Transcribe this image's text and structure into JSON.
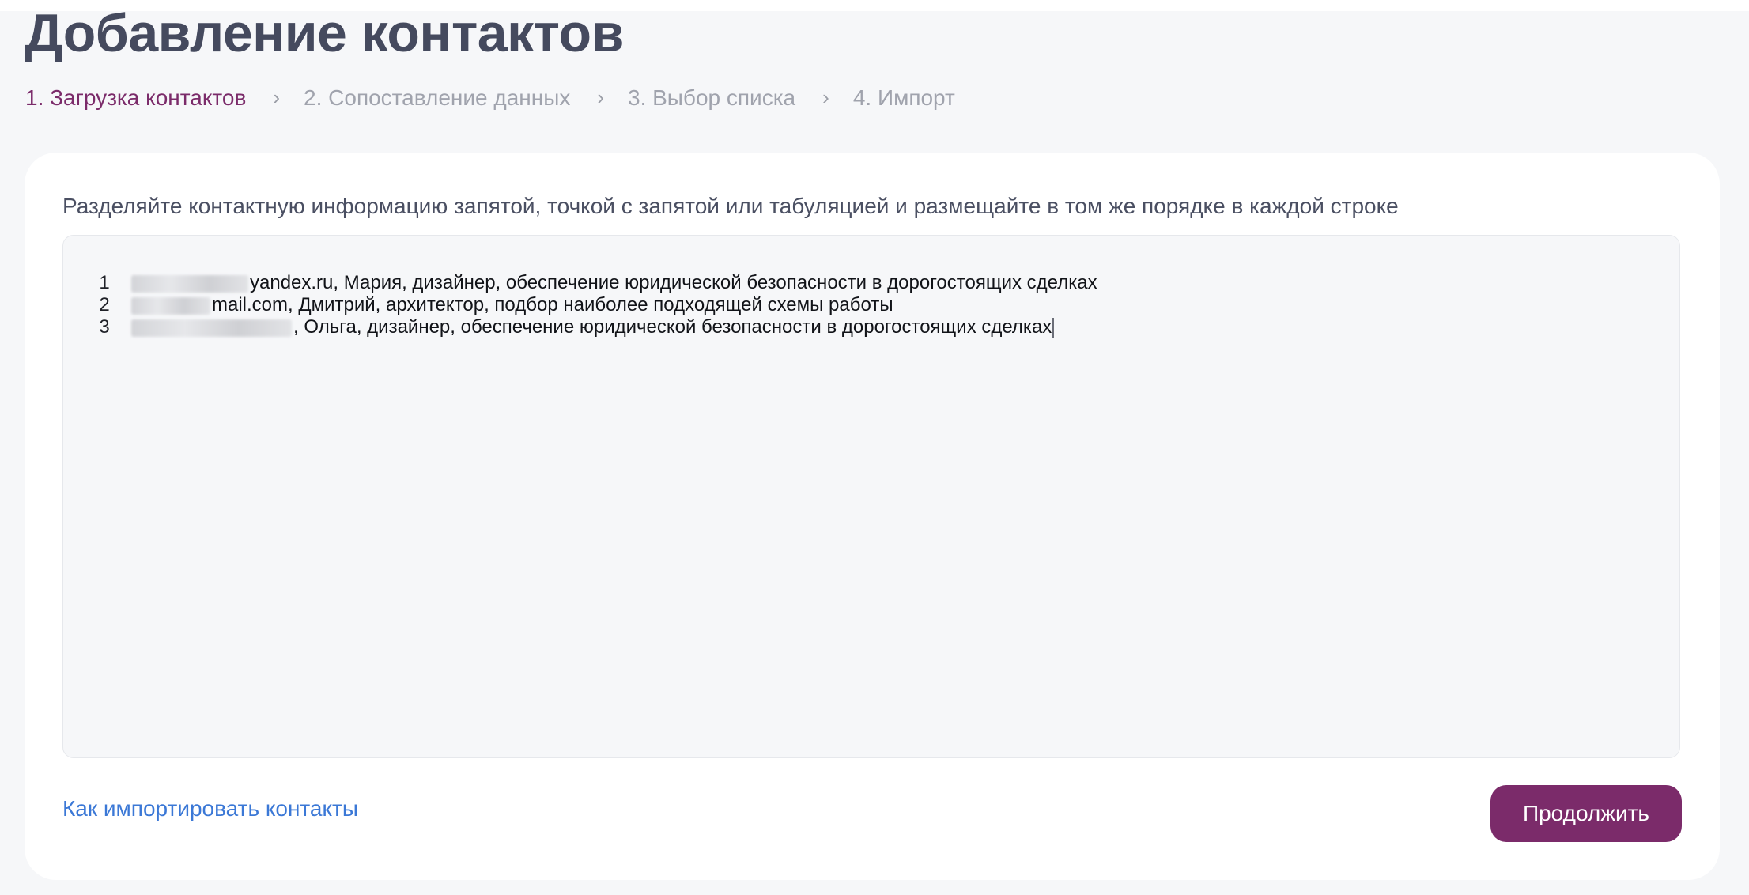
{
  "page": {
    "title": "Добавление контактов"
  },
  "steps": [
    {
      "label": "1. Загрузка контактов",
      "active": true
    },
    {
      "label": "2. Сопоставление данных",
      "active": false
    },
    {
      "label": "3. Выбор списка",
      "active": false
    },
    {
      "label": "4. Импорт",
      "active": false
    }
  ],
  "card": {
    "hint": "Разделяйте контактную информацию запятой, точкой с запятой или табуляцией и размещайте в том же порядке в каждой строке",
    "editor": {
      "lines": [
        {
          "number": "1",
          "visible_text": "yandex.ru, Мария, дизайнер, обеспечение юридической безопасности в дорогостоящих сделках"
        },
        {
          "number": "2",
          "visible_text": "mail.com, Дмитрий, архитектор, подбор наиболее подходящей схемы работы"
        },
        {
          "number": "3",
          "visible_text": ", Ольга, дизайнер, обеспечение юридической безопасности в дорогостоящих сделках"
        }
      ]
    },
    "help_link": "Как импортировать контакты",
    "continue_label": "Продолжить"
  },
  "colors": {
    "accent": "#7b2b6a",
    "link": "#3b78d6",
    "title": "#454a5e",
    "inactive_step": "#a0a3ad",
    "background": "#f6f7f9"
  },
  "icons": {
    "step_separator": "chevron-right-icon"
  }
}
